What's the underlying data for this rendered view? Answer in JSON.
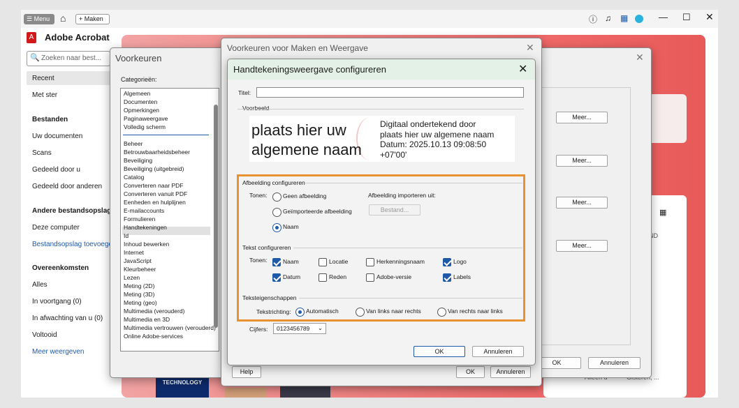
{
  "topbar": {
    "menu": "Menu",
    "maken": "+ Maken"
  },
  "app": {
    "title": "Adobe Acrobat",
    "search_placeholder": "Zoeken naar best..."
  },
  "sidebar": {
    "items": [
      "Recent",
      "Met ster"
    ],
    "bestanden_head": "Bestanden",
    "bestanden": [
      "Uw documenten",
      "Scans",
      "Gedeeld door u",
      "Gedeeld door anderen"
    ],
    "andere_head": "Andere bestandsopslag",
    "andere": [
      "Deze computer",
      "Bestandsopslag toevoegen"
    ],
    "overeenkomsten_head": "Overeenkomsten",
    "overeenkomsten": [
      "Alles",
      "In voortgang (0)",
      "In afwachting van u (0)",
      "Voltooid",
      "Meer weergeven"
    ]
  },
  "background": {
    "meer": "Meer...",
    "ok": "OK",
    "annuleren": "Annuleren",
    "nd": "ND",
    "alleen_u": "Alleen u",
    "gisteren": "Gisteren, ...",
    "technology": "TECHNOLOGY"
  },
  "voorkeuren": {
    "title": "Voorkeuren",
    "categories_label": "Categorieën:",
    "categories_top": [
      "Algemeen",
      "Documenten",
      "Opmerkingen",
      "Paginaweergave",
      "Volledig scherm"
    ],
    "categories": [
      "Beheer",
      "Betrouwbaarheidsbeheer",
      "Beveiliging",
      "Beveiliging (uitgebreid)",
      "Catalog",
      "Converteren naar PDF",
      "Converteren vanuit PDF",
      "Eenheden en hulplijnen",
      "E-mailaccounts",
      "Formulieren",
      "Handtekeningen",
      "Id",
      "Inhoud bewerken",
      "Internet",
      "JavaScript",
      "Kleurbeheer",
      "Lezen",
      "Meting (2D)",
      "Meting (3D)",
      "Meting (geo)",
      "Multimedia (verouderd)",
      "Multimedia en 3D",
      "Multimedia vertrouwen (verouderd)",
      "Online Adobe-services"
    ],
    "selected": "Handtekeningen"
  },
  "maken": {
    "title": "Voorkeuren voor Maken en Weergave",
    "help": "Help",
    "ok": "OK",
    "annuleren": "Annuleren"
  },
  "hw": {
    "title": "Handtekeningsweergave configureren",
    "titel_label": "Titel:",
    "titel_value": "",
    "voorbeeld_label": "Voorbeeld",
    "preview_big1": "plaats hier uw",
    "preview_big2": "algemene naam",
    "preview_small": [
      "Digitaal ondertekend door",
      "plaats hier uw algemene naam",
      "Datum: 2025.10.13 09:08:50",
      "+07'00'"
    ],
    "afb_head": "Afbeelding configureren",
    "tonen": "Tonen:",
    "afb_options": [
      "Geen afbeelding",
      "Geïmporteerde afbeelding",
      "Naam"
    ],
    "afb_selected": "Naam",
    "import_label": "Afbeelding importeren uit:",
    "bestand": "Bestand...",
    "tekst_head": "Tekst configureren",
    "tekst_options": [
      {
        "label": "Naam",
        "checked": true
      },
      {
        "label": "Locatie",
        "checked": false
      },
      {
        "label": "Herkenningsnaam",
        "checked": false
      },
      {
        "label": "Logo",
        "checked": true
      },
      {
        "label": "Datum",
        "checked": true
      },
      {
        "label": "Reden",
        "checked": false
      },
      {
        "label": "Adobe-versie",
        "checked": false
      },
      {
        "label": "Labels",
        "checked": true
      }
    ],
    "eigen_head": "Teksteigenschappen",
    "richting_label": "Tekstrichting:",
    "richting_options": [
      "Automatisch",
      "Van links naar rechts",
      "Van rechts naar links"
    ],
    "richting_selected": "Automatisch",
    "cijfers_label": "Cijfers:",
    "cijfers_value": "0123456789",
    "ok": "OK",
    "annuleren": "Annuleren"
  },
  "colors": {
    "highlight": "#e8912e",
    "accent": "#1e5aa8",
    "hero": "#f06a6a"
  }
}
